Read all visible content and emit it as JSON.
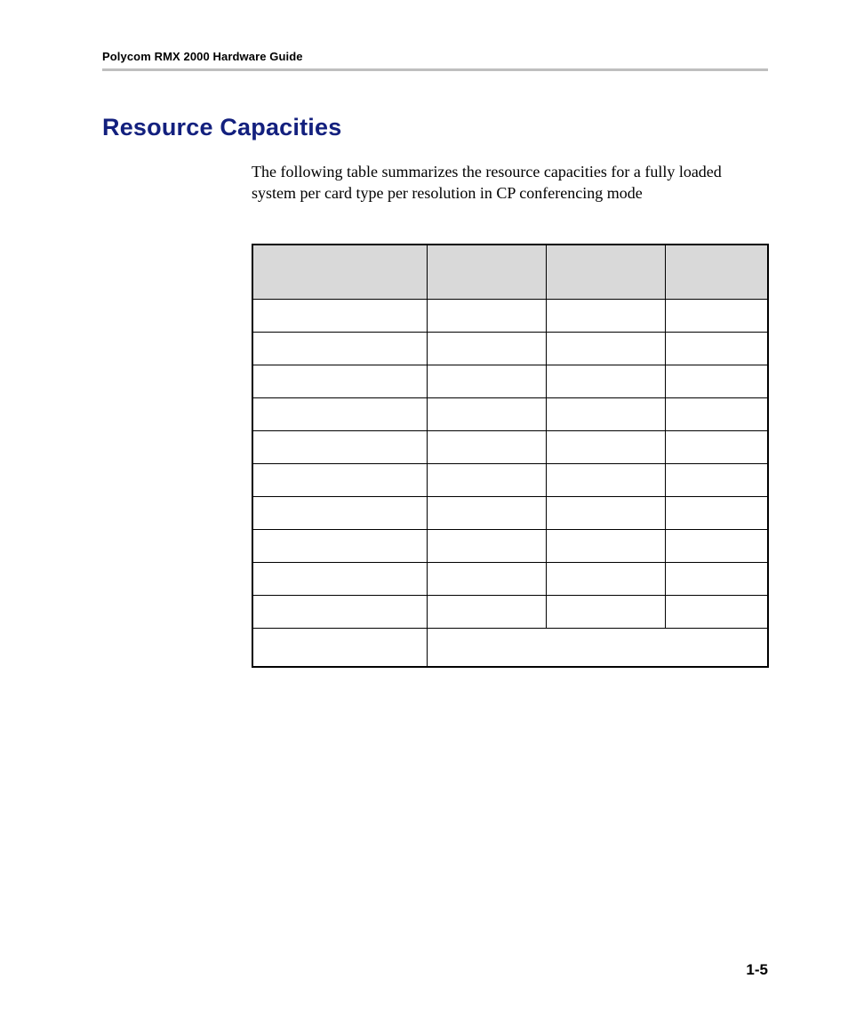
{
  "header": {
    "running_head": "Polycom RMX 2000 Hardware Guide"
  },
  "section": {
    "title": "Resource Capacities",
    "intro": "The following table summarizes the resource capacities for a fully loaded system per card type per resolution in CP conferencing mode"
  },
  "table": {
    "headers": [
      "",
      "",
      "",
      ""
    ],
    "rows": [
      [
        "",
        "",
        "",
        ""
      ],
      [
        "",
        "",
        "",
        ""
      ],
      [
        "",
        "",
        "",
        ""
      ],
      [
        "",
        "",
        "",
        ""
      ],
      [
        "",
        "",
        "",
        ""
      ],
      [
        "",
        "",
        "",
        ""
      ],
      [
        "",
        "",
        "",
        ""
      ],
      [
        "",
        "",
        "",
        ""
      ],
      [
        "",
        "",
        "",
        ""
      ],
      [
        "",
        "",
        "",
        ""
      ],
      [
        "",
        "",
        "",
        ""
      ]
    ]
  },
  "footer": {
    "page_number": "1-5"
  }
}
